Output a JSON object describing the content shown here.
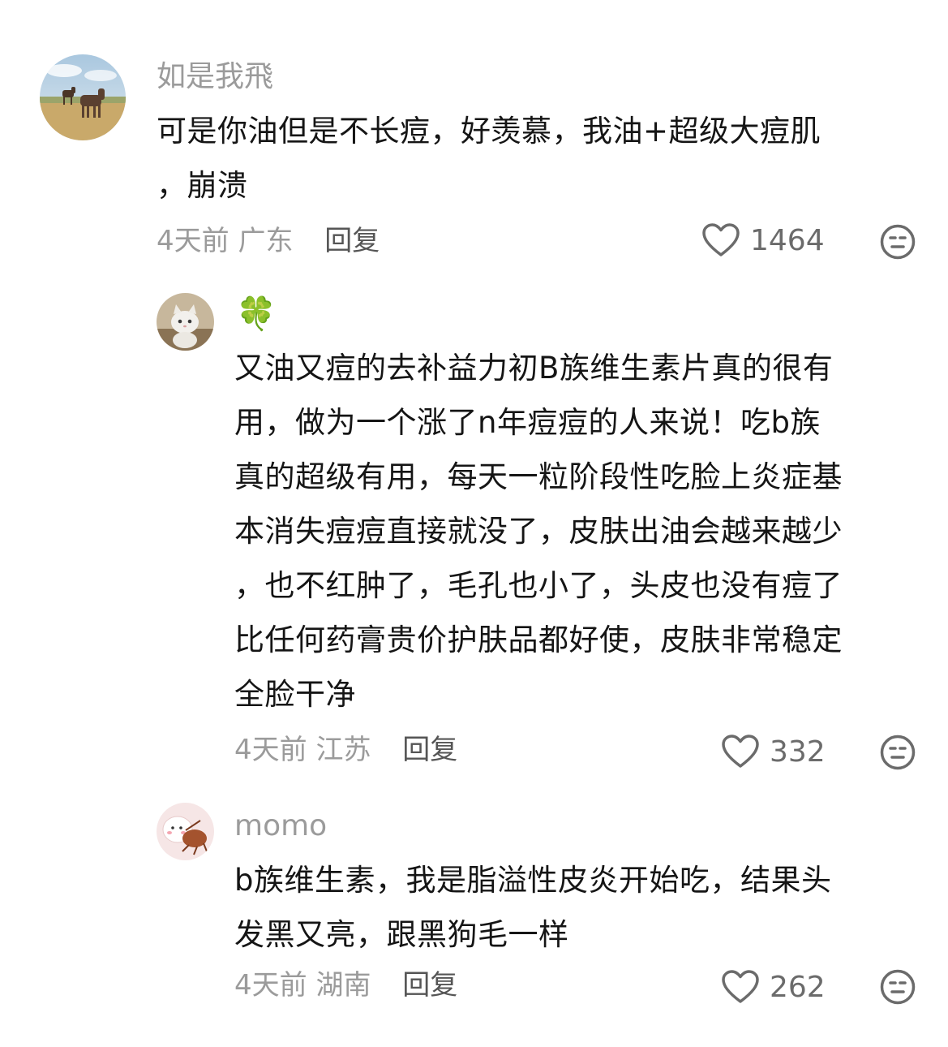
{
  "comments": [
    {
      "username": "如是我飛",
      "lines": [
        "可是你油但是不长痘，好羡慕，我油+超级大痘肌",
        "，崩溃"
      ],
      "time": "4天前",
      "location": "广东",
      "reply_label": "回复",
      "likes": "1464",
      "avatar_icon": "horses-photo"
    },
    {
      "username": "🍀",
      "lines": [
        "又油又痘的去补益力初B族维生素片真的很有",
        "用，做为一个涨了n年痘痘的人来说！吃b族",
        "真的超级有用，每天一粒阶段性吃脸上炎症基",
        "本消失痘痘直接就没了，皮肤出油会越来越少",
        "，也不红肿了，毛孔也小了，头皮也没有痘了",
        "比任何药膏贵价护肤品都好使，皮肤非常稳定",
        "全脸干净"
      ],
      "time": "4天前",
      "location": "江苏",
      "reply_label": "回复",
      "likes": "332",
      "avatar_icon": "cat-photo"
    },
    {
      "username": "momo",
      "lines": [
        "b族维生素，我是脂溢性皮炎开始吃，结果头",
        "发黑又亮，跟黑狗毛一样"
      ],
      "time": "4天前",
      "location": "湖南",
      "reply_label": "回复",
      "likes": "262",
      "avatar_icon": "cartoon-photo"
    }
  ],
  "colors": {
    "meta_gray": "#9b9b9b",
    "text": "#151515",
    "icon_gray": "#6b6b6b"
  }
}
